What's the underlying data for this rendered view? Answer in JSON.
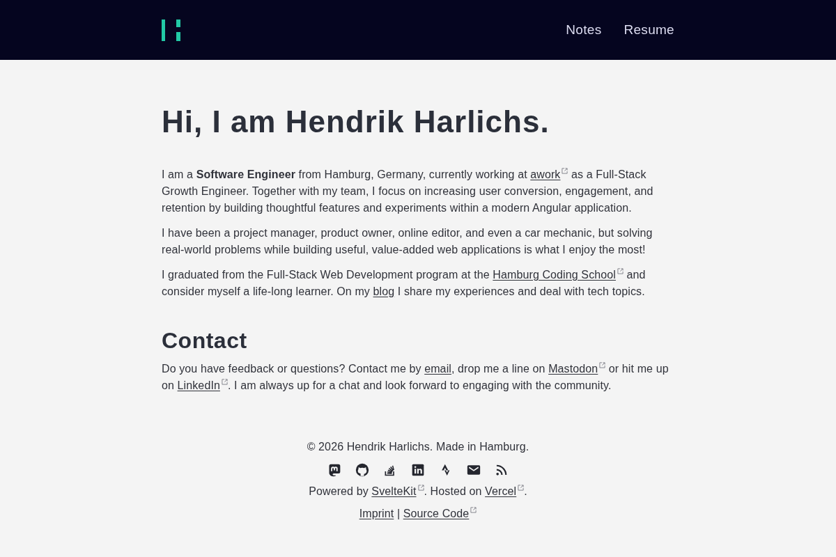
{
  "header": {
    "nav": [
      {
        "label": "Notes"
      },
      {
        "label": "Resume"
      }
    ]
  },
  "intro": {
    "heading": "Hi, I am Hendrik Harlichs.",
    "paragraphs": [
      [
        {
          "kind": "text",
          "text": "I am a **Software Engineer** from Hamburg, Germany, currently working at "
        },
        {
          "kind": "link",
          "text": "awork",
          "external": true
        },
        {
          "kind": "text",
          "text": " as a Full-Stack Growth Engineer. Together with my team, I focus on increasing user conversion, engagement, and retention by building thoughtful features and experiments within a modern Angular application."
        }
      ],
      [
        {
          "kind": "text",
          "text": "I have been a project manager, product owner, online editor, and even a car mechanic, but solving real-world problems while building useful, value-added web applications is what I enjoy the most!"
        }
      ],
      [
        {
          "kind": "text",
          "text": "I graduated from the Full-Stack Web Development program at the "
        },
        {
          "kind": "link",
          "text": "Hamburg Coding School",
          "external": true
        },
        {
          "kind": "text",
          "text": " and consider myself a life-long learner. On my "
        },
        {
          "kind": "link",
          "text": "blog",
          "external": false
        },
        {
          "kind": "text",
          "text": " I share my experiences and deal with tech topics."
        }
      ]
    ]
  },
  "contact": {
    "heading": "Contact",
    "paragraphs": [
      [
        {
          "kind": "text",
          "text": "Do you have feedback or questions? Contact me by "
        },
        {
          "kind": "link",
          "text": "email",
          "external": false
        },
        {
          "kind": "text",
          "text": ", drop me a line on "
        },
        {
          "kind": "link",
          "text": "Mastodon",
          "external": true
        },
        {
          "kind": "text",
          "text": " or hit me up on "
        },
        {
          "kind": "link",
          "text": "LinkedIn",
          "external": true
        },
        {
          "kind": "text",
          "text": ". I am always up for a chat and look forward to engaging with the community."
        }
      ]
    ]
  },
  "footer": {
    "copyright": "© 2026 Hendrik Harlichs. Made in Hamburg.",
    "lines": [
      [
        {
          "kind": "text",
          "text": "Powered by "
        },
        {
          "kind": "link",
          "text": "SvelteKit",
          "external": true
        },
        {
          "kind": "text",
          "text": ". Hosted on "
        },
        {
          "kind": "link",
          "text": "Vercel",
          "external": true
        },
        {
          "kind": "text",
          "text": "."
        }
      ],
      [
        {
          "kind": "link",
          "text": "Imprint",
          "external": false
        },
        {
          "kind": "text",
          "text": " | "
        },
        {
          "kind": "link",
          "text": "Source Code",
          "external": true
        }
      ]
    ]
  }
}
